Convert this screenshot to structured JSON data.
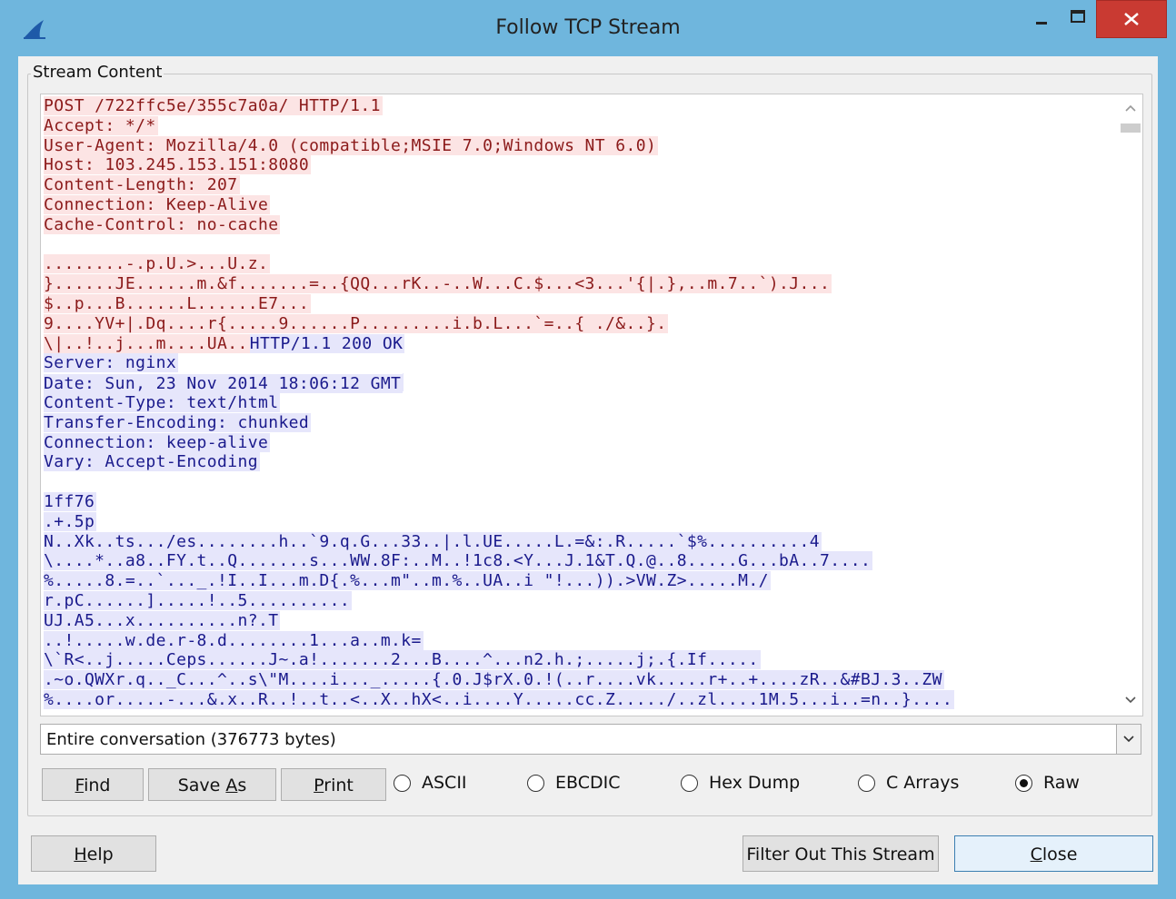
{
  "window": {
    "title": "Follow TCP Stream"
  },
  "group": {
    "label": "Stream Content"
  },
  "stream": {
    "client_header": [
      "POST /722ffc5e/355c7a0a/ HTTP/1.1",
      "Accept: */*",
      "User-Agent: Mozilla/4.0 (compatible;MSIE 7.0;Windows NT 6.0)",
      "Host: 103.245.153.151:8080",
      "Content-Length: 207",
      "Connection: Keep-Alive",
      "Cache-Control: no-cache"
    ],
    "client_body": [
      "........-.p.U.>...U.z.",
      "}......JE......m.&f.......=..{QQ...rK..-..W...C.$...<3...'{|.},..m.7..`).J...",
      "$..p...B......L......E7...",
      "9....YV+|.Dq....r{.....9......P.........i.b.L...`=..{ ./&..}."
    ],
    "boundary_client": "\\|..!..j...m....UA..",
    "boundary_server": "HTTP/1.1 200 OK",
    "server_header": [
      "Server: nginx",
      "Date: Sun, 23 Nov 2014 18:06:12 GMT",
      "Content-Type: text/html",
      "Transfer-Encoding: chunked",
      "Connection: keep-alive",
      "Vary: Accept-Encoding"
    ],
    "server_body": [
      "1ff76",
      ".+.5p",
      "N..Xk..ts.../es........h..`9.q.G...33..|.l.UE.....L.=&:.R.....`$%..........4",
      "\\....*..a8..FY.t..Q.......s...WW.8F:..M..!1c8.<Y...J.1&T.Q.@..8.....G...bA..7....",
      "%.....8.=..`..._.!I..I...m.D{.%...m\"..m.%..UA..i \"!...)).>VW.Z>.....M./",
      "r.pC......].....!..5..........",
      "UJ.A5...x..........n?.T",
      "..!.....w.de.r-8.d........1...a..m.k=",
      "\\`R<..j.....Ceps......J~.a!.......2...B....^...n2.h.;.....j;.{.If.....",
      ".~o.QWXr.q.._C...^..s\\\"M....i..._.....{.0.J$rX.0.!(..r....vk.....r+..+....zR..&#BJ.3..ZW",
      "%....or.....-...&.x..R..!..t..<..X..hX<..i....Y.....cc.Z...../..zl....1M.5...i..=n..}...."
    ]
  },
  "combo": {
    "value": "Entire conversation (376773 bytes)"
  },
  "buttons": {
    "find_pre": "",
    "find_u": "F",
    "find_post": "ind",
    "saveas_pre": "Save ",
    "saveas_u": "A",
    "saveas_post": "s",
    "print_pre": "",
    "print_u": "P",
    "print_post": "rint",
    "help_pre": "",
    "help_u": "H",
    "help_post": "elp",
    "filter": "Filter Out This Stream",
    "close_pre": "",
    "close_u": "C",
    "close_post": "lose"
  },
  "format_options": [
    {
      "label": "ASCII",
      "selected": false
    },
    {
      "label": "EBCDIC",
      "selected": false
    },
    {
      "label": "Hex Dump",
      "selected": false
    },
    {
      "label": "C Arrays",
      "selected": false
    },
    {
      "label": "Raw",
      "selected": true
    }
  ],
  "colors": {
    "client_bg": "#fce4e4",
    "client_fg": "#8b1a1a",
    "server_bg": "#e6e6fb",
    "server_fg": "#1a1a8c",
    "close_button": "#c93a32"
  }
}
